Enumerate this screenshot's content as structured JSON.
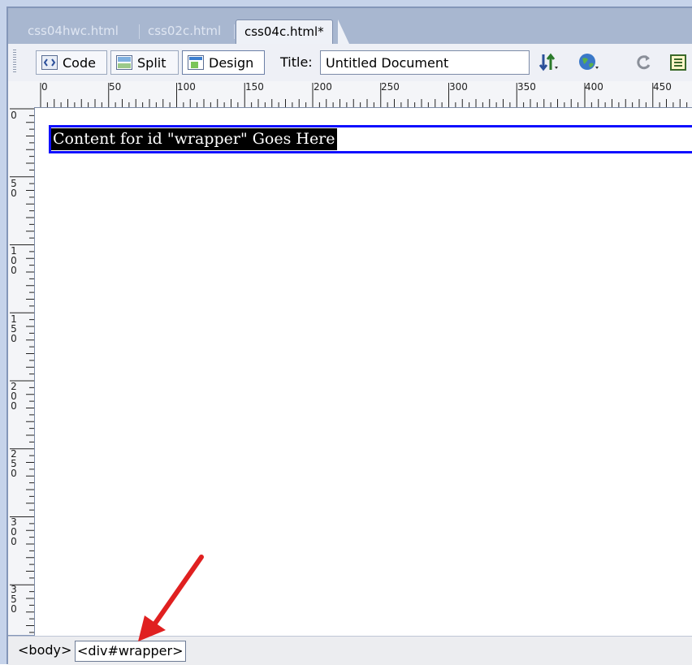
{
  "tabs": [
    {
      "label": "css04hwc.html",
      "active": false
    },
    {
      "label": "css02c.html",
      "active": false
    },
    {
      "label": "css04c.html*",
      "active": true
    }
  ],
  "toolbar": {
    "code_label": "Code",
    "split_label": "Split",
    "design_label": "Design",
    "title_label": "Title:",
    "title_value": "Untitled Document",
    "icons": [
      "file-management-icon",
      "preview-browser-icon",
      "refresh-icon",
      "view-options-icon"
    ]
  },
  "ruler": {
    "horizontal_ticks": [
      "0",
      "50",
      "100",
      "150",
      "200",
      "250",
      "300",
      "350",
      "400",
      "450"
    ],
    "vertical_ticks": [
      "0",
      "50",
      "100",
      "150",
      "200",
      "250",
      "300",
      "350"
    ]
  },
  "canvas": {
    "wrapper_text": "Content for id \"wrapper\" Goes Here",
    "wrapper_border_color": "#1010ff"
  },
  "status_bar": {
    "tags": [
      "<body>",
      "<div#wrapper>"
    ],
    "selected_tag": "<div#wrapper>"
  },
  "annotation": {
    "arrow_color": "#e02020"
  }
}
